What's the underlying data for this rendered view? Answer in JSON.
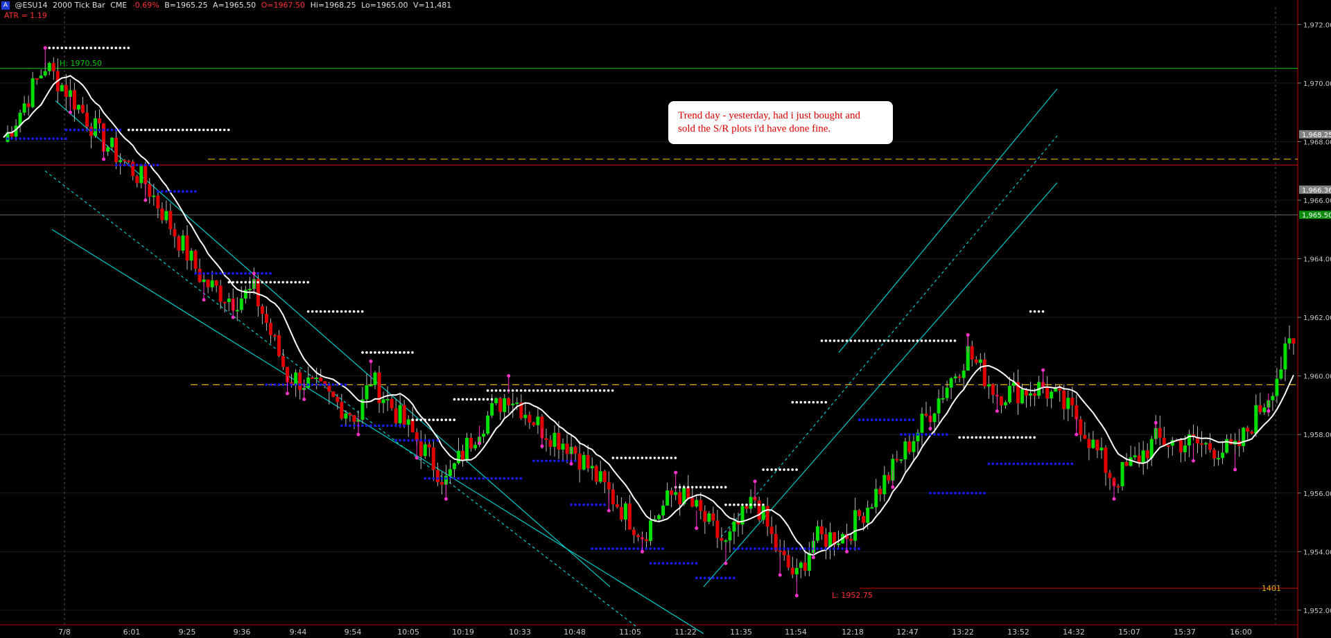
{
  "header": {
    "badge": "A",
    "symbol": "@ESU14",
    "bar_type": "2000 Tick Bar",
    "exchange": "CME",
    "change": "-0.69%",
    "bid": "B=1965.25",
    "ask": "A=1965.50",
    "open": "O=1967.50",
    "high": "Hi=1968.25",
    "low": "Lo=1965.00",
    "volume": "V=11,481"
  },
  "indicator": {
    "atr_label": "ATR = 1.19"
  },
  "annotation": {
    "line1": "Trend day - yesterday, had i just bought and",
    "line2": "sold the S/R plots i'd have done fine."
  },
  "colors": {
    "background": "#000000",
    "up_bar": "#00e000",
    "down_bar": "#e00000",
    "ma_line": "#ffffff",
    "channel": "#00cccc",
    "support_dots": "#1a1aff",
    "resistance_dots": "#ffffff",
    "pivot_marker": "#ff33cc",
    "dashed_level": "#e0b000",
    "high_line": "#00cc00",
    "low_line": "#cc0000"
  },
  "chart_data": {
    "type": "candlestick",
    "y_range": [
      1951.5,
      1972.6
    ],
    "y_ticks": [
      "1,952.00",
      "1,954.00",
      "1,956.00",
      "1,958.00",
      "1,960.00",
      "1,962.00",
      "1,964.00",
      "1,966.00",
      "1,968.00",
      "1,970.00",
      "1,972.00"
    ],
    "x_ticks": [
      "7/8",
      "6:01",
      "9:25",
      "9:36",
      "9:44",
      "9:54",
      "10:05",
      "10:19",
      "10:33",
      "10:48",
      "11:05",
      "11:22",
      "11:35",
      "11:54",
      "12:18",
      "12:47",
      "13:22",
      "13:52",
      "14:32",
      "15:07",
      "15:37",
      "16:00"
    ],
    "price_tags": [
      {
        "label": "1,968.25",
        "value": 1968.25,
        "color": "#808080"
      },
      {
        "label": "1,966.36",
        "value": 1966.36,
        "color": "#808080"
      },
      {
        "label": "1,965.50",
        "value": 1965.5,
        "color": "#0a8a0a"
      }
    ],
    "high_label": "H: 1970.50",
    "high_value": 1970.5,
    "low_label": "L: 1952.75",
    "low_value": 1952.75,
    "bar_count_label": "1401",
    "dashed_levels": [
      1967.4,
      1959.7
    ],
    "prior_low_level": 1967.2,
    "pivot_waypoints": [
      [
        0,
        1968.0
      ],
      [
        10,
        1970.6
      ],
      [
        16,
        1969.6
      ],
      [
        24,
        1968.0
      ],
      [
        34,
        1966.6
      ],
      [
        48,
        1963.2
      ],
      [
        55,
        1962.6
      ],
      [
        60,
        1962.9
      ],
      [
        68,
        1960.0
      ],
      [
        72,
        1959.8
      ],
      [
        85,
        1958.6
      ],
      [
        88,
        1959.9
      ],
      [
        99,
        1957.8
      ],
      [
        106,
        1956.4
      ],
      [
        114,
        1958.3
      ],
      [
        121,
        1959.4
      ],
      [
        129,
        1958.2
      ],
      [
        136,
        1957.6
      ],
      [
        145,
        1956.0
      ],
      [
        153,
        1954.6
      ],
      [
        161,
        1956.1
      ],
      [
        166,
        1955.4
      ],
      [
        173,
        1954.2
      ],
      [
        180,
        1955.8
      ],
      [
        186,
        1953.8
      ],
      [
        190,
        1953.1
      ],
      [
        194,
        1954.4
      ],
      [
        202,
        1954.6
      ],
      [
        213,
        1956.8
      ],
      [
        222,
        1958.8
      ],
      [
        231,
        1960.8
      ],
      [
        238,
        1959.4
      ],
      [
        249,
        1959.6
      ],
      [
        257,
        1958.6
      ],
      [
        266,
        1956.4
      ],
      [
        276,
        1957.8
      ],
      [
        285,
        1957.7
      ],
      [
        295,
        1957.4
      ],
      [
        303,
        1959.4
      ],
      [
        308,
        1961.0
      ]
    ],
    "support_levels": [
      {
        "value": 1968.1,
        "from": 1,
        "to": 15
      },
      {
        "value": 1968.4,
        "from": 15,
        "to": 28
      },
      {
        "value": 1967.2,
        "from": 27,
        "to": 37
      },
      {
        "value": 1966.3,
        "from": 37,
        "to": 46
      },
      {
        "value": 1963.5,
        "from": 46,
        "to": 64
      },
      {
        "value": 1959.7,
        "from": 63,
        "to": 82
      },
      {
        "value": 1958.3,
        "from": 81,
        "to": 96
      },
      {
        "value": 1957.8,
        "from": 94,
        "to": 104
      },
      {
        "value": 1956.5,
        "from": 101,
        "to": 124
      },
      {
        "value": 1957.1,
        "from": 127,
        "to": 137
      },
      {
        "value": 1955.6,
        "from": 136,
        "to": 144
      },
      {
        "value": 1954.1,
        "from": 141,
        "to": 158
      },
      {
        "value": 1953.6,
        "from": 155,
        "to": 166
      },
      {
        "value": 1953.1,
        "from": 166,
        "to": 175
      },
      {
        "value": 1954.1,
        "from": 175,
        "to": 205
      },
      {
        "value": 1958.5,
        "from": 205,
        "to": 218
      },
      {
        "value": 1958.0,
        "from": 215,
        "to": 226
      },
      {
        "value": 1956.0,
        "from": 222,
        "to": 235
      },
      {
        "value": 1957.0,
        "from": 236,
        "to": 256
      }
    ],
    "resistance_levels": [
      {
        "value": 1971.2,
        "from": 11,
        "to": 30
      },
      {
        "value": 1968.4,
        "from": 30,
        "to": 54
      },
      {
        "value": 1963.2,
        "from": 54,
        "to": 73
      },
      {
        "value": 1962.2,
        "from": 73,
        "to": 86
      },
      {
        "value": 1960.8,
        "from": 86,
        "to": 98
      },
      {
        "value": 1958.5,
        "from": 98,
        "to": 108
      },
      {
        "value": 1959.2,
        "from": 108,
        "to": 117
      },
      {
        "value": 1959.5,
        "from": 116,
        "to": 146
      },
      {
        "value": 1957.2,
        "from": 146,
        "to": 161
      },
      {
        "value": 1956.2,
        "from": 161,
        "to": 173
      },
      {
        "value": 1955.6,
        "from": 173,
        "to": 182
      },
      {
        "value": 1956.8,
        "from": 182,
        "to": 190
      },
      {
        "value": 1959.1,
        "from": 189,
        "to": 197
      },
      {
        "value": 1961.2,
        "from": 196,
        "to": 228
      },
      {
        "value": 1957.9,
        "from": 229,
        "to": 247
      },
      {
        "value": 1962.2,
        "from": 246,
        "to": 249
      }
    ],
    "channels": {
      "down": {
        "a": [
          [
            80,
            1969.4
          ],
          [
            880,
            1952.8
          ]
        ],
        "b": [
          [
            75,
            1965.0
          ],
          [
            1015,
            1951.2
          ]
        ],
        "mid": [
          [
            65,
            1967.0
          ],
          [
            920,
            1951.4
          ]
        ]
      },
      "up": {
        "a": [
          [
            1210,
            1960.8
          ],
          [
            1525,
            1969.8
          ]
        ],
        "b": [
          [
            1015,
            1952.8
          ],
          [
            1525,
            1966.6
          ]
        ],
        "mid": [
          [
            1040,
            1954.5
          ],
          [
            1525,
            1968.2
          ]
        ]
      }
    }
  }
}
